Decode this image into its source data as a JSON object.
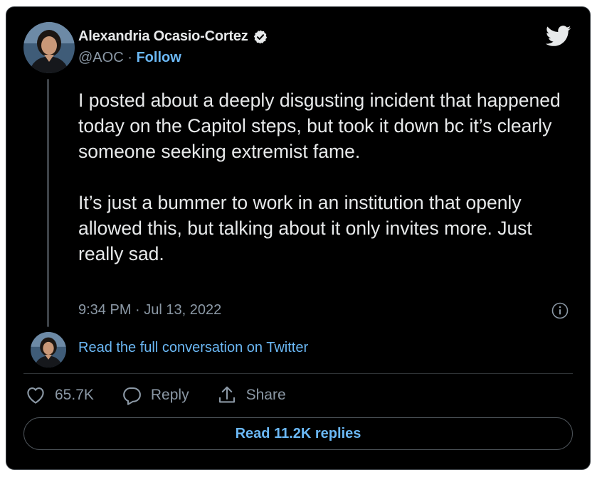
{
  "author": {
    "name": "Alexandria Ocasio-Cortez",
    "handle": "@AOC",
    "separator": "·",
    "follow_label": "Follow"
  },
  "tweet": {
    "paragraphs": [
      "I posted about a deeply disgusting incident that happened today on the Capitol steps, but took it down bc it’s clearly someone seeking extremist fame.",
      "It’s just a bummer to work in an institution that openly allowed this, but talking about it only invites more. Just really sad."
    ],
    "timestamp": "9:34 PM · Jul 13, 2022"
  },
  "conversation_link": "Read the full conversation on Twitter",
  "actions": {
    "like_count": "65.7K",
    "reply_label": "Reply",
    "share_label": "Share"
  },
  "replies_button": "Read 11.2K replies",
  "icons": {
    "verified": "verified-badge-icon",
    "logo": "twitter-bird-icon",
    "info": "info-icon",
    "like": "heart-icon",
    "reply": "speech-bubble-icon",
    "share": "share-arrow-icon"
  },
  "colors": {
    "background": "#000000",
    "text": "#e7e9ea",
    "secondary_text": "#8b98a5",
    "link": "#6bb8f5",
    "border": "#3a3f44"
  }
}
